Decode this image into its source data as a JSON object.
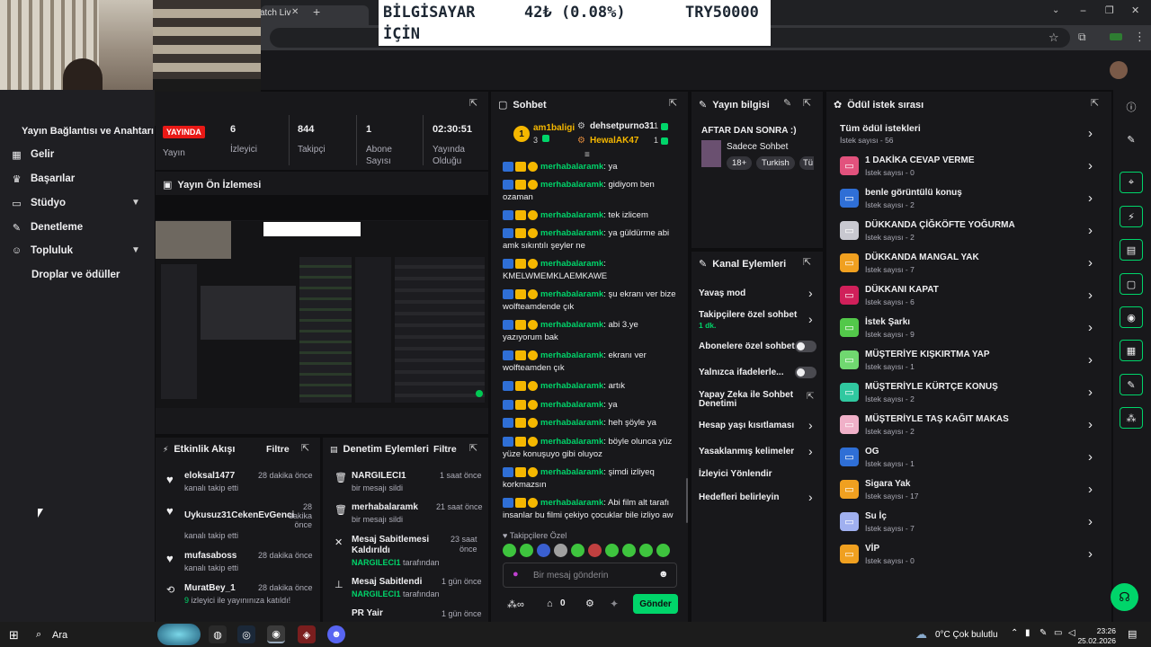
{
  "browser": {
    "tab_title": "atch Liv",
    "new_tab": "+",
    "win_min": "−",
    "win_max": "❐",
    "win_close": "✕"
  },
  "ticker": {
    "name_line1": "BİLGİSAYAR",
    "name_line2": "İÇİN",
    "change": "42₺ (0.08%)",
    "price": "TRY50000"
  },
  "webcam": {
    "label": "Webcam overlay"
  },
  "sidebar": {
    "connection_title": "Yayın Bağlantısı ve Anahtarı",
    "items": [
      {
        "label": "Gelir",
        "icon": "revenue-icon"
      },
      {
        "label": "Başarılar",
        "icon": "trophy-icon"
      },
      {
        "label": "Stüdyo",
        "icon": "studio-icon"
      },
      {
        "label": "Denetleme",
        "icon": "wrench-icon"
      },
      {
        "label": "Topluluk",
        "icon": "community-icon"
      },
      {
        "label": "Droplar ve ödüller",
        "icon": ""
      }
    ]
  },
  "stats": {
    "live_badge": "YAYINDA",
    "live_label": "Yayın",
    "viewers_value": "6",
    "viewers_label": "İzleyici",
    "followers_value": "844",
    "followers_label": "Takipçi",
    "subs_value": "1",
    "subs_label_1": "Abone",
    "subs_label_2": "Sayısı",
    "uptime_value": "02:30:51",
    "uptime_label_1": "Yayında",
    "uptime_label_2": "Olduğu"
  },
  "preview": {
    "title": "Yayın Ön İzlemesi"
  },
  "activity": {
    "title": "Etkinlik Akışı",
    "filter": "Filtre",
    "items": [
      {
        "name": "eloksal1477",
        "sub": "kanalı takip etti",
        "time": "28 dakika önce"
      },
      {
        "name": "Uykusuz31CekenEvGenci",
        "sub": "kanalı takip etti",
        "time_1": "28",
        "time_2": "dakika",
        "time_3": "önce"
      },
      {
        "name": "mufasaboss",
        "sub": "kanalı takip etti",
        "time": "28 dakika önce"
      },
      {
        "name": "MuratBey_1",
        "sub_green": "9",
        "sub": "izleyici ile yayınınıza katıldı!",
        "time": "28 dakika önce"
      }
    ]
  },
  "modlog": {
    "title": "Denetim Eylemleri",
    "filter": "Filtre",
    "items": [
      {
        "name": "NARGILECI1",
        "sub": "bir mesajı sildi",
        "time": "1 saat önce"
      },
      {
        "name": "merhabalaramk",
        "sub": "bir mesajı sildi",
        "time": "21 saat önce"
      },
      {
        "name_1": "Mesaj Sabitlemesi",
        "name_2": "Kaldırıldı",
        "sub_user": "NARGILECI1",
        "sub": "tarafından",
        "time_1": "23 saat",
        "time_2": "önce"
      },
      {
        "name": "Mesaj Sabitlendi",
        "sub_user": "NARGILECI1",
        "sub": "tarafından",
        "time": "1 gün önce"
      },
      {
        "name": "PR Yair",
        "time": "1 gün önce"
      }
    ]
  },
  "chat": {
    "title": "Sohbet",
    "leader1_name": "am1baligi",
    "leader1_count": "3",
    "leader2_name": "dehsetpurno31",
    "leader2_count": "1",
    "leader3_name": "HewalAK47",
    "leader3_count": "1",
    "messages": [
      {
        "user": "merhabalaramk",
        "text": "ya"
      },
      {
        "user": "merhabalaramk",
        "text": "gidiyom ben",
        "text2": "ozaman"
      },
      {
        "user": "merhabalaramk",
        "text": "tek izlicem"
      },
      {
        "user": "merhabalaramk",
        "text": "ya güldürme abi",
        "text2": "amk sıkıntılı şeyler ne"
      },
      {
        "user": "merhabalaramk",
        "text": "",
        "text2": "KMELWMEMKLAEMKAWE"
      },
      {
        "user": "merhabalaramk",
        "text": "şu ekranı ver bize",
        "text2": "wolfteamdende çık"
      },
      {
        "user": "merhabalaramk",
        "text": "abi 3.ye",
        "text2": "yazıyorum bak"
      },
      {
        "user": "merhabalaramk",
        "text": "ekranı ver",
        "text2": "wolfteamden çık"
      },
      {
        "user": "merhabalaramk",
        "text": "artık"
      },
      {
        "user": "merhabalaramk",
        "text": "ya"
      },
      {
        "user": "merhabalaramk",
        "text": "heh şöyle ya"
      },
      {
        "user": "merhabalaramk",
        "text": "böyle olunca yüz",
        "text2": "yüze konuşuyo gibi oluyoz"
      },
      {
        "user": "merhabalaramk",
        "text": "şimdi izliyeq",
        "text2": "korkmazsın"
      },
      {
        "user": "merhabalaramk",
        "text": "Abi film alt tarafı",
        "text2": "insanlar bu filmi çekiyo çocuklar bile izliyo aw"
      }
    ],
    "followers_only": "Takipçilere Özel",
    "placeholder": "Bir mesaj gönderin",
    "points": "0",
    "send": "Gönder"
  },
  "streaminfo": {
    "title": "Yayın bilgisi",
    "stream_title": "AFTAR DAN SONRA :)",
    "category": "Sadece Sohbet",
    "tags": [
      "18+",
      "Turkish",
      "Tü"
    ]
  },
  "channel_actions": {
    "title": "Kanal Eylemleri",
    "slow": "Yavaş mod",
    "followers_1": "Takipçilere özel sohbet",
    "followers_2": "1 dk.",
    "subs": "Abonelere özel sohbet",
    "emotes": "Yalnızca ifadelerle...",
    "ai_1": "Yapay Zeka ile Sohbet",
    "ai_2": "Denetimi",
    "age": "Hesap yaşı kısıtlaması",
    "banned": "Yasaklanmış kelimeler",
    "redirect": "İzleyici Yönlendir",
    "goals": "Hedefleri belirleyin"
  },
  "rewards": {
    "title": "Ödül istek sırası",
    "all": "Tüm ödül istekleri",
    "all_count": "İstek sayısı - 56",
    "items": [
      {
        "title": "1 DAKİKA CEVAP VERME",
        "count": "İstek sayısı - 0",
        "color": "#e2527d"
      },
      {
        "title": "benle görüntülü konuş",
        "count": "İstek sayısı - 2",
        "color": "#2f6fd6"
      },
      {
        "title": "DÜKKANDA ÇİĞKÖFTE YOĞURMA",
        "count": "İstek sayısı - 2",
        "color": "#c8c8d0"
      },
      {
        "title": "DÜKKANDA MANGAL YAK",
        "count": "İstek sayısı - 7",
        "color": "#f0a020"
      },
      {
        "title": "DÜKKANI KAPAT",
        "count": "İstek sayısı - 6",
        "color": "#d0205a"
      },
      {
        "title": "İstek Şarkı",
        "count": "İstek sayısı - 9",
        "color": "#53c84a"
      },
      {
        "title": "MÜŞTERİYE KIŞKIRTMA YAP",
        "count": "İstek sayısı - 1",
        "color": "#70d870"
      },
      {
        "title": "MÜŞTERİYLE KÜRTÇE KONUŞ",
        "count": "İstek sayısı - 2",
        "color": "#30c8a0"
      },
      {
        "title": "MÜŞTERİYLE TAŞ KAĞIT MAKAS",
        "count": "İstek sayısı - 2",
        "color": "#f0b0c8"
      },
      {
        "title": "OG",
        "count": "İstek sayısı - 1",
        "color": "#2f6fd6"
      },
      {
        "title": "Sigara Yak",
        "count": "İstek sayısı - 17",
        "color": "#f0a020"
      },
      {
        "title": "Su İç",
        "count": "İstek sayısı - 7",
        "color": "#a0b0f0"
      },
      {
        "title": "VİP",
        "count": "İstek sayısı - 0",
        "color": "#f0a020"
      }
    ]
  },
  "taskbar": {
    "search": "Ara",
    "weather": "0°C  Çok bulutlu",
    "time": "23:26",
    "date": "25.02.2026"
  }
}
